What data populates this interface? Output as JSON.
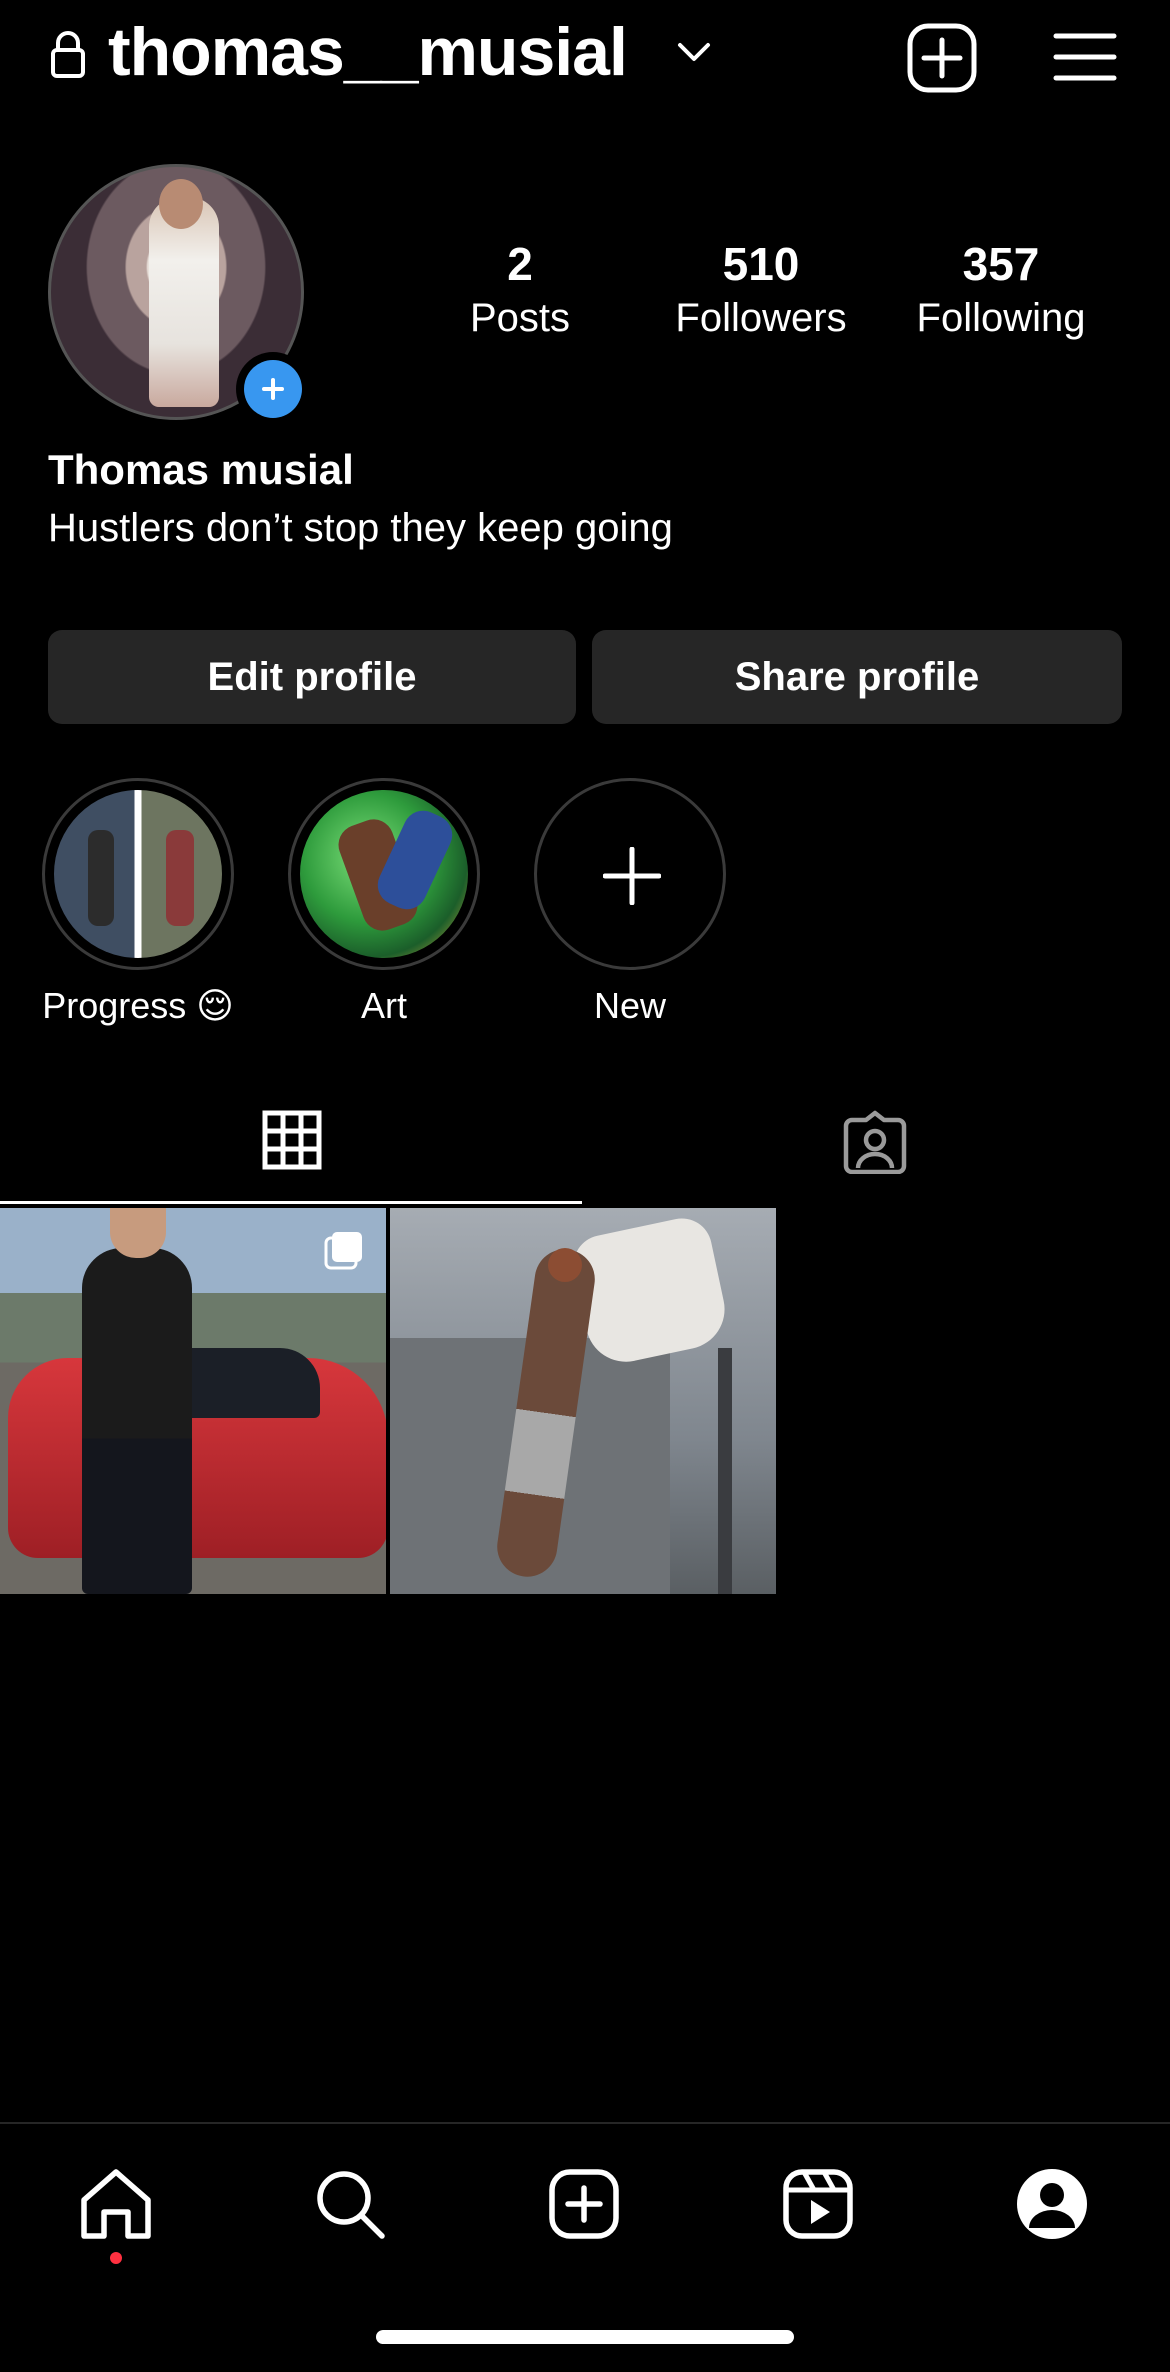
{
  "header": {
    "username": "thomas__musial",
    "icons": {
      "lock": "lock-icon",
      "caret": "chevron-down-icon",
      "create": "plus-square-icon",
      "menu": "hamburger-menu-icon"
    }
  },
  "profile": {
    "display_name": "Thomas musial",
    "bio": "Hustlers don’t stop they keep going",
    "stats": {
      "posts": {
        "value": "2",
        "label": "Posts"
      },
      "followers": {
        "value": "510",
        "label": "Followers"
      },
      "following": {
        "value": "357",
        "label": "Following"
      }
    },
    "buttons": {
      "edit": "Edit profile",
      "share": "Share profile"
    }
  },
  "highlights": [
    {
      "label": "Progress 😌"
    },
    {
      "label": "Art"
    },
    {
      "label": "New"
    }
  ],
  "tabs": {
    "grid_icon": "grid-icon",
    "tagged_icon": "tagged-person-icon",
    "active": "grid"
  },
  "posts": [
    {
      "icon": "multiple-images-icon"
    },
    {
      "icon": ""
    }
  ],
  "nav": {
    "items": [
      "home-icon",
      "search-icon",
      "create-icon",
      "reels-icon",
      "profile-icon"
    ],
    "notification_color": "#ff3040"
  },
  "colors": {
    "background": "#000000",
    "button": "#262626",
    "accent": "#3897f0"
  }
}
